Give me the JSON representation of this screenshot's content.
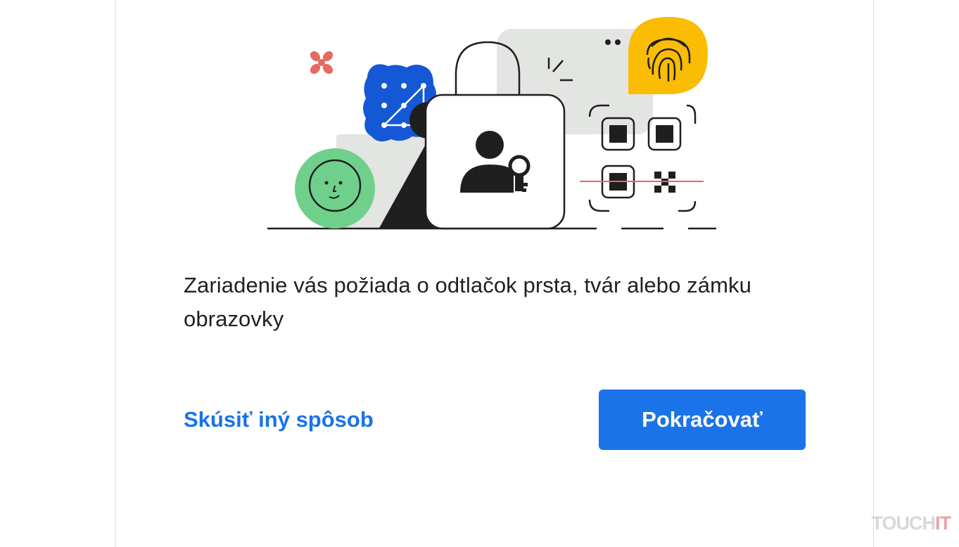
{
  "content": {
    "message": "Zariadenie vás požiada o odtlačok prsta, tvár alebo zámku obrazovky",
    "alt_link": "Skúsiť iný spôsob",
    "primary_button": "Pokračovať"
  },
  "illustration_icons": [
    "face-icon",
    "pattern-lock-icon",
    "padlock-icon",
    "user-key-icon",
    "fingerprint-icon",
    "qr-code-icon",
    "sparkle-icon"
  ],
  "watermark": {
    "prefix": "TOUCH",
    "suffix": "IT"
  },
  "colors": {
    "accent": "#1a73e8",
    "text": "#202124",
    "green": "#6fd08c",
    "blue": "#1558d6",
    "yellow": "#fbbc04",
    "red": "#e46a5e"
  }
}
